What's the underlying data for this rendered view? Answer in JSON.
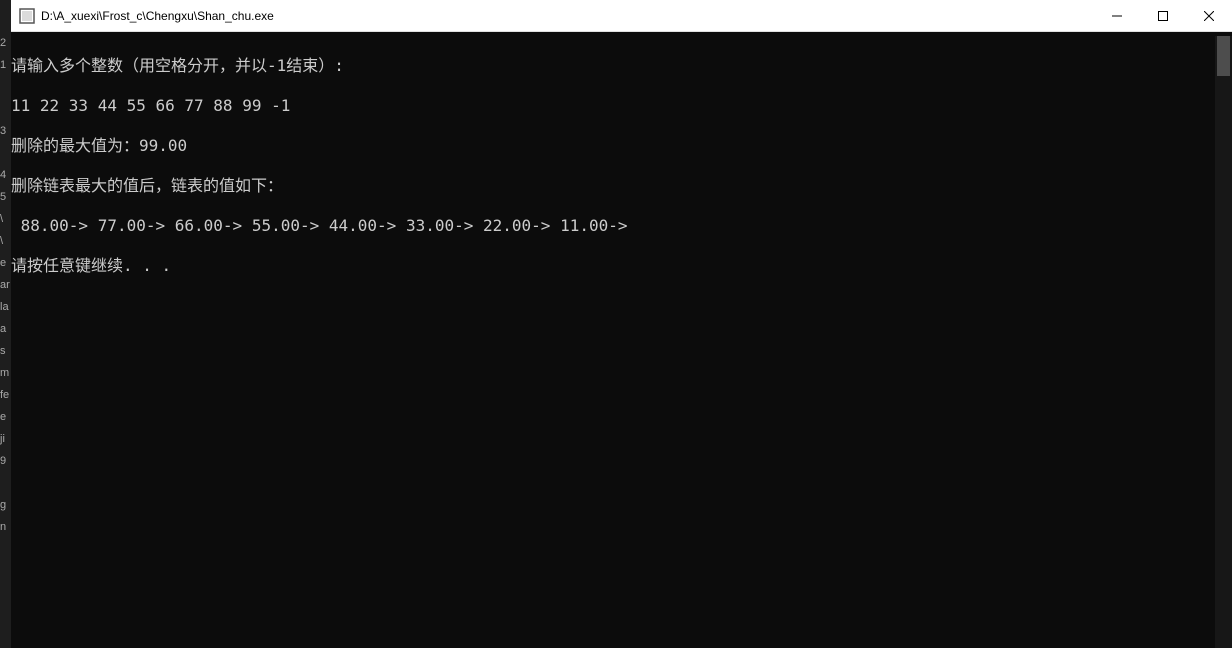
{
  "window": {
    "title": "D:\\A_xuexi\\Frost_c\\Chengxu\\Shan_chu.exe"
  },
  "leftStrip": {
    "items": [
      "2",
      "1",
      "",
      "",
      "3",
      "",
      "4",
      "5",
      "\\",
      "\\",
      "e",
      "ar",
      "la",
      "a",
      "s",
      "m",
      "fe",
      "e",
      "ji",
      "9",
      "",
      "g",
      "n"
    ]
  },
  "console": {
    "lines": [
      "请输入多个整数（用空格分开，并以-1结束）:",
      "11 22 33 44 55 66 77 88 99 -1",
      "删除的最大值为：99.00",
      "删除链表最大的值后，链表的值如下：",
      " 88.00-> 77.00-> 66.00-> 55.00-> 44.00-> 33.00-> 22.00-> 11.00->",
      "请按任意键继续. . ."
    ]
  }
}
